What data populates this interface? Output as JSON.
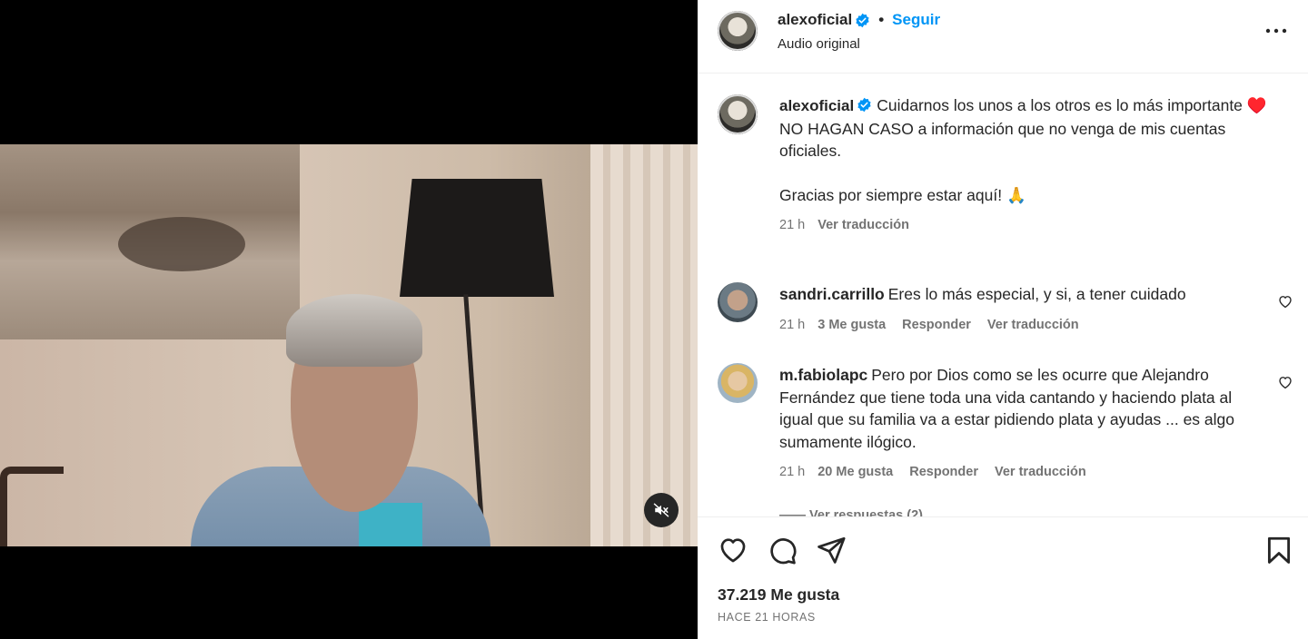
{
  "media": {
    "mute_icon": "speaker-muted-icon"
  },
  "header": {
    "username": "alexoficial",
    "separator": "•",
    "follow_label": "Seguir",
    "audio_label": "Audio original",
    "more_icon": "more-options-icon"
  },
  "caption": {
    "username": "alexoficial",
    "text": "Cuidarnos los unos a los otros es lo más importante ♥️\nNO HAGAN CASO a información que no venga de mis cuentas oficiales.\n\nGracias por siempre estar aquí! 🙏",
    "time": "21 h",
    "translate": "Ver traducción"
  },
  "comments": [
    {
      "username": "sandri.carrillo",
      "text": "Eres lo más especial, y si, a tener cuidado",
      "time": "21 h",
      "likes": "3 Me gusta",
      "reply": "Responder",
      "translate": "Ver traducción"
    },
    {
      "username": "m.fabiolapc",
      "text": "Pero por Dios como se les ocurre que Alejandro Fernández que tiene toda una vida cantando y haciendo plata al igual que su familia va a estar pidiendo plata y ayudas ... es algo sumamente ilógico.",
      "time": "21 h",
      "likes": "20 Me gusta",
      "reply": "Responder",
      "translate": "Ver traducción"
    }
  ],
  "more_replies": "—— Ver respuestas (2)",
  "footer": {
    "likes": "37.219 Me gusta",
    "when": "HACE 21 HORAS"
  },
  "colors": {
    "accent": "#0095f6",
    "verified": "#0095f6",
    "muted_text": "#737373"
  }
}
